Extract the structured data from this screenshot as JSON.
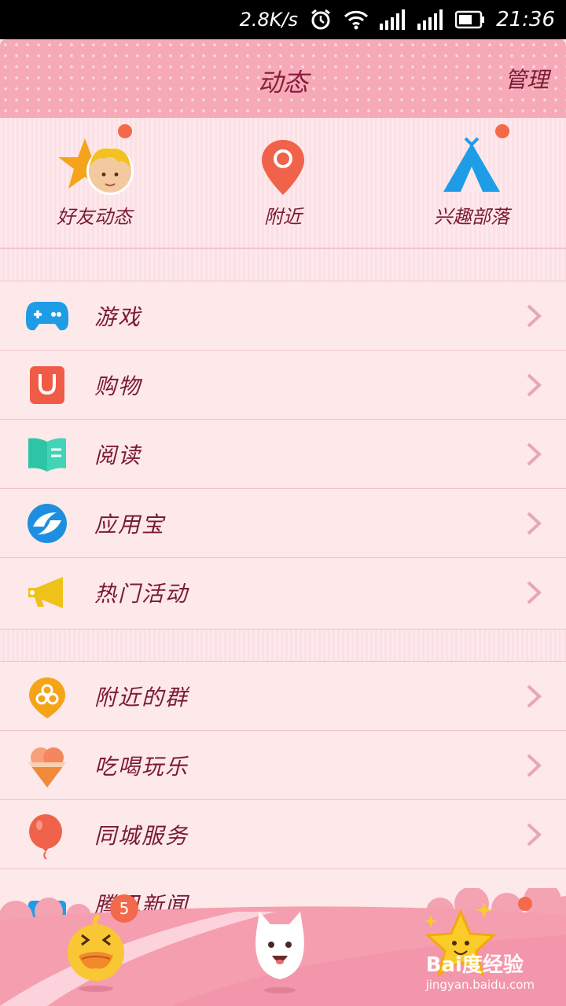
{
  "status_bar": {
    "speed": "2.8K/s",
    "time": "21:36"
  },
  "header": {
    "title": "动态",
    "manage": "管理"
  },
  "quick_entries": [
    {
      "label": "好友动态",
      "icon": "qzone-star-avatar-icon",
      "has_dot": true
    },
    {
      "label": "附近",
      "icon": "location-pin-icon",
      "has_dot": false
    },
    {
      "label": "兴趣部落",
      "icon": "tent-icon",
      "has_dot": true
    }
  ],
  "section1": [
    {
      "label": "游戏",
      "icon": "gamepad-icon"
    },
    {
      "label": "购物",
      "icon": "shopping-bag-icon"
    },
    {
      "label": "阅读",
      "icon": "book-icon"
    },
    {
      "label": "应用宝",
      "icon": "app-store-icon"
    },
    {
      "label": "热门活动",
      "icon": "megaphone-icon"
    }
  ],
  "section2": [
    {
      "label": "附近的群",
      "icon": "nearby-group-icon"
    },
    {
      "label": "吃喝玩乐",
      "icon": "ice-cream-icon"
    },
    {
      "label": "同城服务",
      "icon": "balloon-icon"
    },
    {
      "label": "腾讯新闻",
      "icon": "news-icon"
    }
  ],
  "tab_bar": {
    "messages_badge": "5",
    "tabs": [
      {
        "icon": "duck-messages-icon"
      },
      {
        "icon": "cat-contacts-icon"
      },
      {
        "icon": "star-dynamics-icon"
      }
    ]
  },
  "watermark": {
    "line1": "Bai度经验",
    "line2": "jingyan.baidu.com"
  },
  "colors": {
    "accent_red": "#f26a4b",
    "text_maroon": "#7a1a34",
    "header_pink": "#f6aab8"
  }
}
